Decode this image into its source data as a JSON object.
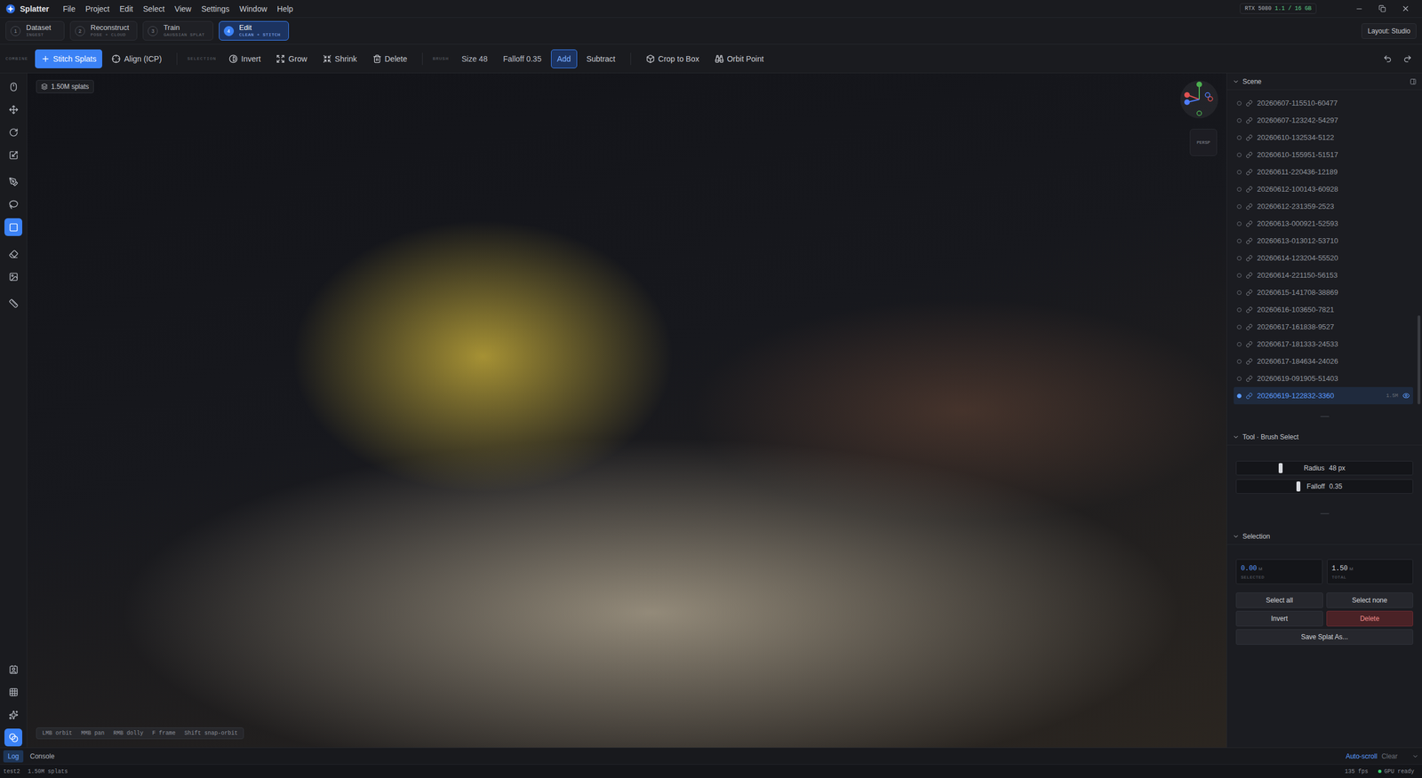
{
  "app": {
    "name": "Splatter"
  },
  "menu": [
    "File",
    "Project",
    "Edit",
    "Select",
    "View",
    "Settings",
    "Window",
    "Help"
  ],
  "gpu": {
    "name": "RTX 5080",
    "memory": "1.1 / 16 GB"
  },
  "stages": [
    {
      "number": "1",
      "label": "Dataset",
      "sub": "INGEST",
      "selected": false
    },
    {
      "number": "2",
      "label": "Reconstruct",
      "sub": "POSE + CLOUD",
      "selected": false
    },
    {
      "number": "3",
      "label": "Train",
      "sub": "GAUSSIAN SPLAT",
      "selected": false
    },
    {
      "number": "4",
      "label": "Edit",
      "sub": "CLEAN + STITCH",
      "selected": true
    }
  ],
  "layout_button": "Layout: Studio",
  "toolbar": {
    "groups": [
      {
        "label": "COMBINE",
        "items": [
          {
            "label": "Stitch Splats",
            "kind": "primary"
          },
          {
            "label": "Align (ICP)",
            "kind": "button"
          }
        ]
      },
      {
        "label": "SELECTION",
        "items": [
          {
            "label": "Invert",
            "kind": "button"
          },
          {
            "label": "Grow",
            "kind": "button"
          },
          {
            "label": "Shrink",
            "kind": "button"
          },
          {
            "label": "Delete",
            "kind": "button"
          }
        ]
      },
      {
        "label": "BRUSH",
        "items": [
          {
            "label": "Size 48",
            "kind": "value"
          },
          {
            "label": "Falloff 0.35",
            "kind": "value"
          },
          {
            "label": "Add",
            "kind": "toggle",
            "selected": true
          },
          {
            "label": "Subtract",
            "kind": "toggle",
            "selected": false
          }
        ]
      },
      {
        "items": [
          {
            "label": "Crop to Box",
            "kind": "button"
          },
          {
            "label": "Orbit Point",
            "kind": "button"
          }
        ]
      }
    ]
  },
  "tools": {
    "top": [
      {
        "selected": false
      },
      {
        "selected": false
      },
      {
        "selected": false
      },
      {
        "selected": false
      },
      {
        "selected": false
      },
      {
        "selected": false
      },
      {
        "selected": true
      },
      {
        "selected": false
      },
      {
        "selected": false
      },
      {
        "selected": false
      }
    ],
    "bottom": [
      {
        "selected": false
      },
      {
        "selected": false
      },
      {
        "selected": false
      },
      {
        "selected": true
      }
    ]
  },
  "viewport": {
    "badge": "1.50M splats",
    "projection": "PERSP",
    "hints": [
      "LMB orbit",
      "MMB pan",
      "RMB dolly",
      "F frame",
      "Shift snap-orbit"
    ]
  },
  "scene": {
    "title": "Scene",
    "items": [
      {
        "name": "20260607-115510-60477",
        "selected": false
      },
      {
        "name": "20260607-123242-54297",
        "selected": false
      },
      {
        "name": "20260610-132534-5122",
        "selected": false
      },
      {
        "name": "20260610-155951-51517",
        "selected": false
      },
      {
        "name": "20260611-220436-12189",
        "selected": false
      },
      {
        "name": "20260612-100143-60928",
        "selected": false
      },
      {
        "name": "20260612-231359-2523",
        "selected": false
      },
      {
        "name": "20260613-000921-52593",
        "selected": false
      },
      {
        "name": "20260613-013012-53710",
        "selected": false
      },
      {
        "name": "20260614-123204-55520",
        "selected": false
      },
      {
        "name": "20260614-221150-56153",
        "selected": false
      },
      {
        "name": "20260615-141708-38869",
        "selected": false
      },
      {
        "name": "20260616-103650-7821",
        "selected": false
      },
      {
        "name": "20260617-161838-9527",
        "selected": false
      },
      {
        "name": "20260617-181333-24533",
        "selected": false
      },
      {
        "name": "20260617-184634-24026",
        "selected": false
      },
      {
        "name": "20260619-091905-51403",
        "selected": false
      },
      {
        "name": "20260619-122832-3360",
        "selected": true,
        "count": "1.5M",
        "visible": true
      }
    ]
  },
  "brush": {
    "title": "Tool · Brush Select",
    "sliders": [
      {
        "label": "Radius",
        "value": "48 px",
        "level": 0.25
      },
      {
        "label": "Falloff",
        "value": "0.35",
        "level": 0.35
      }
    ]
  },
  "selection": {
    "title": "Selection",
    "stats": [
      {
        "value": "0.00",
        "unit": "M",
        "label": "SELECTED",
        "highlight": true
      },
      {
        "value": "1.50",
        "unit": "M",
        "label": "TOTAL",
        "highlight": false
      }
    ],
    "buttons": [
      {
        "label": "Select all",
        "kind": "button"
      },
      {
        "label": "Select none",
        "kind": "button"
      },
      {
        "label": "Invert",
        "kind": "button"
      },
      {
        "label": "Delete",
        "kind": "danger"
      },
      {
        "label": "Save Splat As...",
        "kind": "wide"
      }
    ]
  },
  "log": {
    "tabs": [
      {
        "label": "Log",
        "selected": true
      },
      {
        "label": "Console",
        "selected": false
      }
    ],
    "autoscroll": {
      "label": "Auto-scroll",
      "on": true
    },
    "clear": "Clear"
  },
  "status": {
    "project": "test2",
    "splats": "1.50M splats",
    "fps": "135 fps",
    "gpu": "GPU ready"
  }
}
